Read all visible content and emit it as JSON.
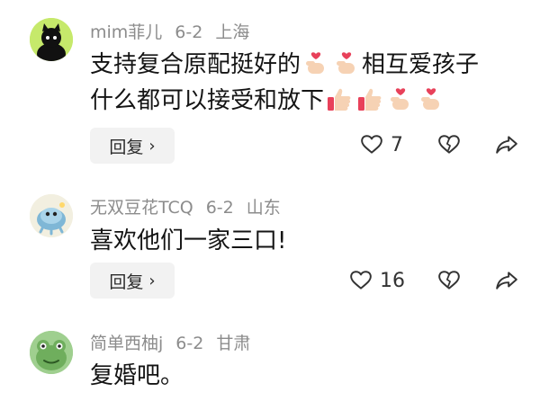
{
  "comments": [
    {
      "username": "mim菲儿",
      "date": "6-2",
      "location": "上海",
      "line1_part1": "支持复合原配挺好的",
      "line1_part2": "相互爱孩子",
      "line2": "什么都可以接受和放下",
      "reply_label": "回复",
      "like_count": "7",
      "avatar_icon": "black-cat-avatar",
      "emojis_line1": [
        "finger-heart-emoji",
        "finger-heart-emoji"
      ],
      "emojis_line2": [
        "thumbs-up-emoji",
        "thumbs-up-emoji",
        "finger-heart-emoji",
        "finger-heart-emoji"
      ]
    },
    {
      "username": "无双豆花TCQ",
      "date": "6-2",
      "location": "山东",
      "text": "喜欢他们一家三口!",
      "reply_label": "回复",
      "like_count": "16",
      "avatar_icon": "fish-avatar"
    },
    {
      "username": "简单西柚j",
      "date": "6-2",
      "location": "甘肃",
      "text": "复婚吧。",
      "avatar_icon": "frog-avatar"
    }
  ],
  "icons": {
    "reply_chevron": "chevron-right-icon",
    "like": "heart-icon",
    "dislike": "broken-heart-icon",
    "share": "share-arrow-icon"
  },
  "colors": {
    "meta_text": "#8c8c8c",
    "reply_bg": "#f2f2f2",
    "emoji_heart": "#e8415a",
    "emoji_skin": "#f6d2b4"
  }
}
